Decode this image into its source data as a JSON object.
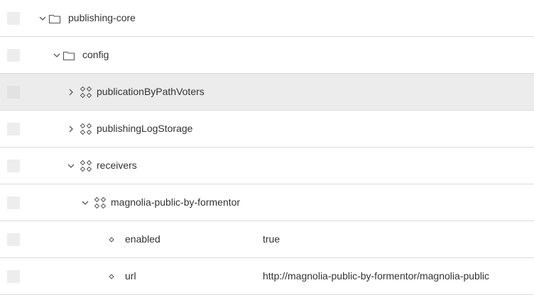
{
  "tree": {
    "rows": [
      {
        "label": "publishing-core",
        "icon": "folder-icon",
        "expanded": true
      },
      {
        "label": "config",
        "icon": "folder-icon",
        "expanded": true
      },
      {
        "label": "publicationByPathVoters",
        "icon": "content-node-icon",
        "expanded": false,
        "selected": true
      },
      {
        "label": "publishingLogStorage",
        "icon": "content-node-icon",
        "expanded": false
      },
      {
        "label": "receivers",
        "icon": "content-node-icon",
        "expanded": true
      },
      {
        "label": "magnolia-public-by-formentor",
        "icon": "content-node-icon",
        "expanded": true
      },
      {
        "label": "enabled",
        "icon": "property-icon",
        "value": "true"
      },
      {
        "label": "url",
        "icon": "property-icon",
        "value": "http://magnolia-public-by-formentor/magnolia-public"
      }
    ]
  },
  "colors": {
    "row_border": "#dcdcdc",
    "selected_row": "#ececec",
    "checkbox": "#ededed",
    "text": "#333333",
    "icon": "#555555"
  }
}
